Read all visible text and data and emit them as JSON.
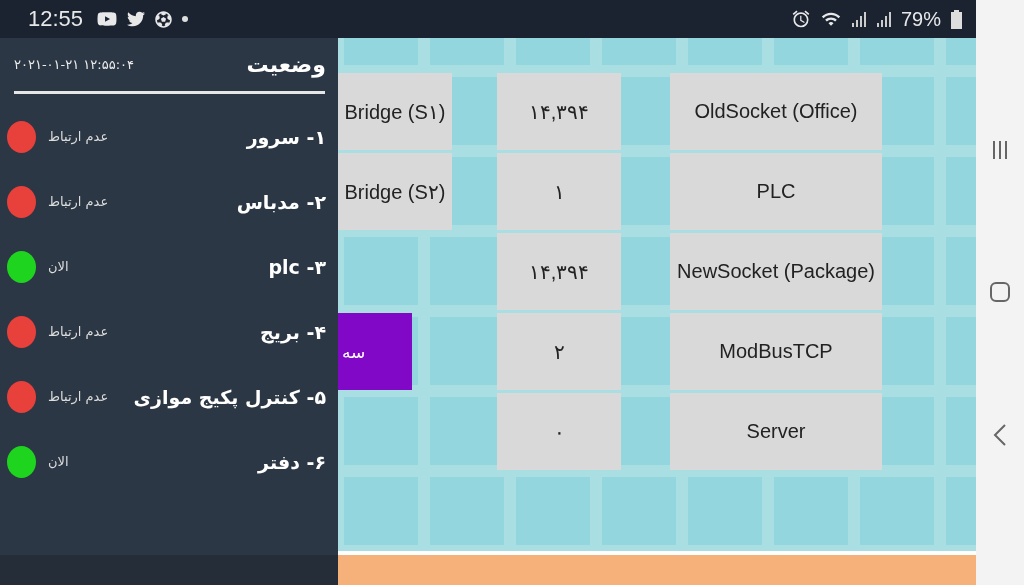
{
  "status_bar": {
    "time": "12:55",
    "battery": "79%"
  },
  "drawer": {
    "title": "وضعیت",
    "timestamp": "۲۰۲۱-۰۱-۲۱ ۱۲:۵۵:۰۴",
    "items": [
      {
        "name": "۱- سرور",
        "status": "عدم ارتباط",
        "color": "#e8403a"
      },
      {
        "name": "۲- مدباس",
        "status": "عدم ارتباط",
        "color": "#e8403a"
      },
      {
        "name": "۳- plc",
        "status": "الان",
        "color": "#1fd41f"
      },
      {
        "name": "۴- بریج",
        "status": "عدم ارتباط",
        "color": "#e8403a"
      },
      {
        "name": "۵- کنترل پکیج موازی",
        "status": "عدم ارتباط",
        "color": "#e8403a"
      },
      {
        "name": "۶- دفتر",
        "status": "الان",
        "color": "#1fd41f"
      }
    ]
  },
  "grid": {
    "rows": [
      {
        "side": "Bridge (S۱)",
        "kind": "card",
        "value": "۱۴,۳۹۴",
        "label": "OldSocket (Office)"
      },
      {
        "side": "Bridge (S۲)",
        "kind": "card",
        "value": "۱",
        "label": "PLC"
      },
      {
        "value": "۱۴,۳۹۴",
        "label": "NewSocket (Package)"
      },
      {
        "side": "سه",
        "kind": "action",
        "value": "۲",
        "label": "ModBusTCP"
      },
      {
        "value": "۰",
        "label": "Server"
      }
    ]
  }
}
